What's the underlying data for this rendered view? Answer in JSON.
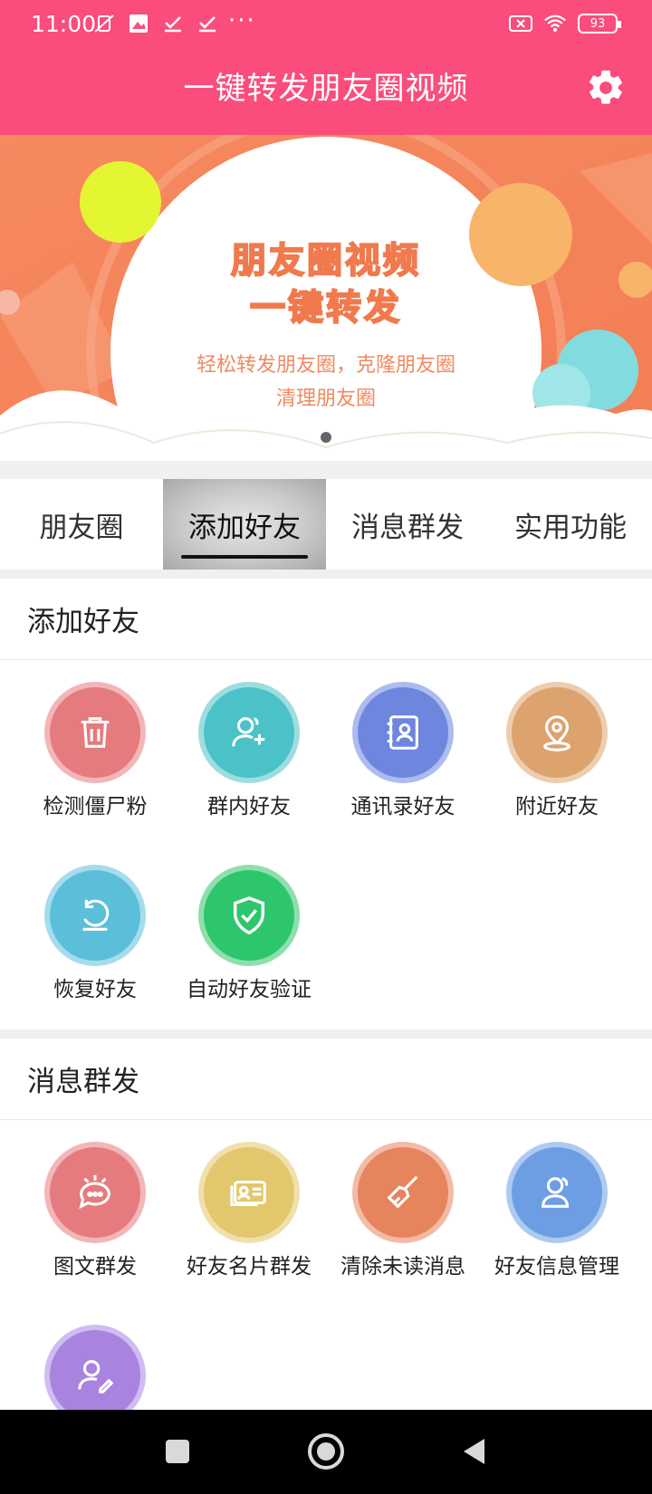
{
  "status_bar": {
    "time": "11:00",
    "more": "···",
    "battery": "93"
  },
  "header": {
    "title": "一键转发朋友圈视频"
  },
  "banner": {
    "title_line1": "朋友圈视频",
    "title_line2": "一键转发",
    "subtitle_line1": "轻松转发朋友圈，克隆朋友圈",
    "subtitle_line2": "清理朋友圈"
  },
  "tabs": [
    {
      "label": "朋友圈",
      "active": false
    },
    {
      "label": "添加好友",
      "active": true
    },
    {
      "label": "消息群发",
      "active": false
    },
    {
      "label": "实用功能",
      "active": false
    }
  ],
  "sections": [
    {
      "title": "添加好友",
      "items": [
        {
          "label": "检测僵尸粉",
          "icon": "trash-icon",
          "color": "#e57b7e"
        },
        {
          "label": "群内好友",
          "icon": "add-user-icon",
          "color": "#4ac2c8"
        },
        {
          "label": "通讯录好友",
          "icon": "contacts-book-icon",
          "color": "#6f86df"
        },
        {
          "label": "附近好友",
          "icon": "location-pin-icon",
          "color": "#dca36e"
        },
        {
          "label": "恢复好友",
          "icon": "restore-icon",
          "color": "#5bbfd9"
        },
        {
          "label": "自动好友验证",
          "icon": "shield-check-icon",
          "color": "#2dc66c"
        }
      ]
    },
    {
      "title": "消息群发",
      "items": [
        {
          "label": "图文群发",
          "icon": "chat-bubble-icon",
          "color": "#e57b7e"
        },
        {
          "label": "好友名片群发",
          "icon": "business-card-icon",
          "color": "#e2c76c"
        },
        {
          "label": "清除未读消息",
          "icon": "broom-icon",
          "color": "#e6845e"
        },
        {
          "label": "好友信息管理",
          "icon": "user-info-icon",
          "color": "#6d9ee4"
        },
        {
          "label": "",
          "icon": "user-edit-icon",
          "color": "#a983e0"
        }
      ]
    }
  ]
}
